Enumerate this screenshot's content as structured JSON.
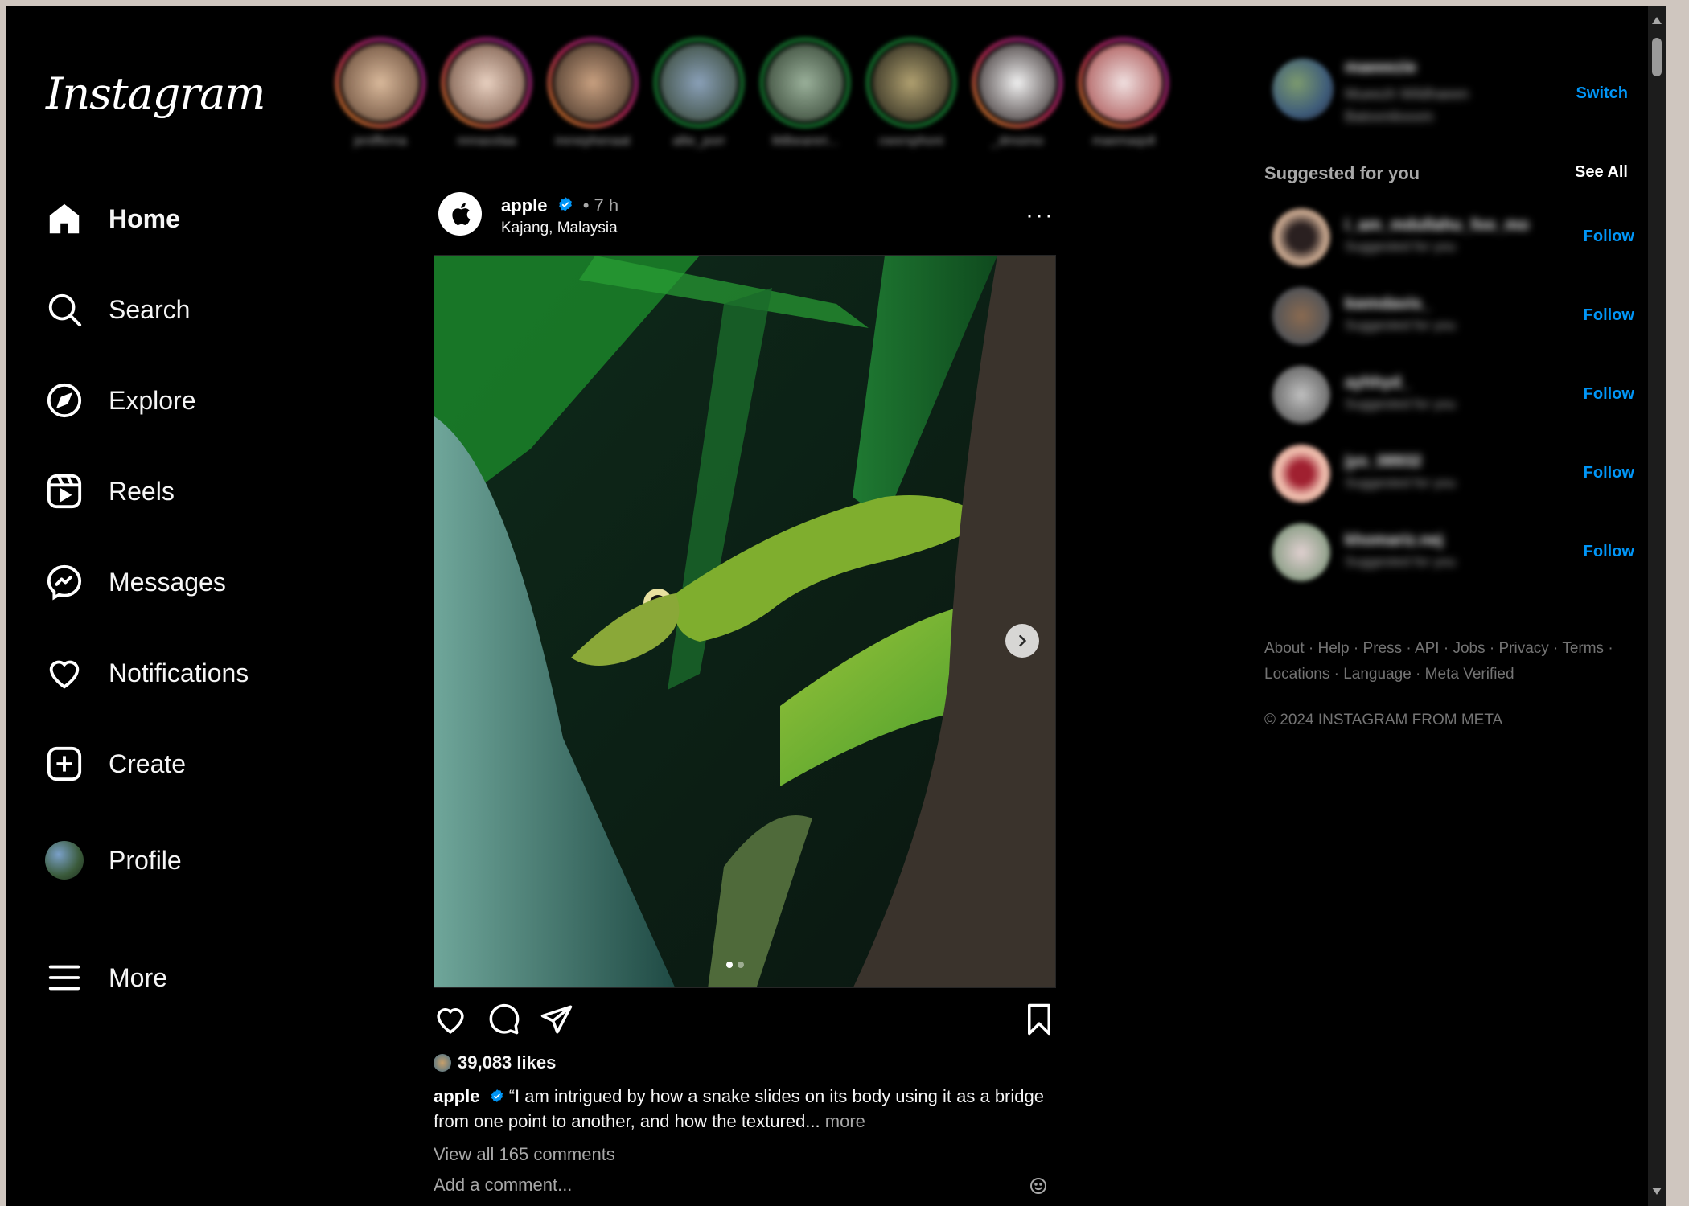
{
  "app": {
    "logo_text": "Instagram"
  },
  "nav": [
    {
      "label": "Home",
      "icon": "home-icon",
      "active": true
    },
    {
      "label": "Search",
      "icon": "search-icon"
    },
    {
      "label": "Explore",
      "icon": "compass-icon"
    },
    {
      "label": "Reels",
      "icon": "reels-icon"
    },
    {
      "label": "Messages",
      "icon": "messenger-icon"
    },
    {
      "label": "Notifications",
      "icon": "heart-icon"
    },
    {
      "label": "Create",
      "icon": "plus-square-icon"
    },
    {
      "label": "Profile",
      "icon": "avatar"
    },
    {
      "label": "More",
      "icon": "hamburger-icon"
    }
  ],
  "stories": [
    {
      "username": "jenifferna"
    },
    {
      "username": "nnnaxxlaa"
    },
    {
      "username": "irenephenaat"
    },
    {
      "username": "allie_porr"
    },
    {
      "username": "littlbeareri..."
    },
    {
      "username": "cwxrsphoni"
    },
    {
      "username": "_dmsimo"
    },
    {
      "username": "maemaqoll"
    }
  ],
  "post": {
    "username": "apple",
    "time": "• 7 h",
    "location": "Kajang, Malaysia",
    "menu": "···",
    "likes": "39,083 likes",
    "caption_user": "apple",
    "caption_text": "“I am intrigued by how a snake slides on its body using it as a bridge from one point to another, and how the textured...",
    "more": "more",
    "view_comments": "View all 165 comments",
    "add_comment_placeholder": "Add a comment...",
    "carousel_page": 1,
    "carousel_pages": 2
  },
  "account": {
    "username": "maeeezie",
    "fullname": "Mueezh Wildhaeen Batoonilooom",
    "switch": "Switch"
  },
  "suggestions": {
    "title": "Suggested for you",
    "see_all": "See All",
    "follow": "Follow",
    "items": [
      {
        "username": "i_am_mdullahu_foo_mo",
        "sub": "Suggested for you"
      },
      {
        "username": "kwmdavis_",
        "sub": "Suggested for you"
      },
      {
        "username": "ayhhyd_",
        "sub": "Suggested for you"
      },
      {
        "username": "jyo_08932",
        "sub": "Suggested for you"
      },
      {
        "username": "khomariz.nej",
        "sub": "Suggested for you"
      }
    ]
  },
  "footer": {
    "links": [
      "About",
      "Help",
      "Press",
      "API",
      "Jobs",
      "Privacy",
      "Terms",
      "Locations",
      "Language",
      "Meta Verified"
    ],
    "copyright": "© 2024 INSTAGRAM FROM META"
  },
  "colors": {
    "accent": "#0095f6",
    "background": "#000000",
    "muted": "#a8a8a8"
  }
}
